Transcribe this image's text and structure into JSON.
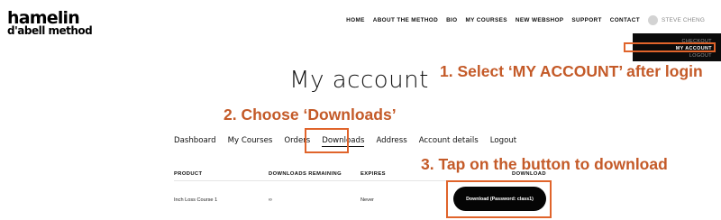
{
  "logo": {
    "line1": "hamelin",
    "line2": "d'abell method"
  },
  "nav": {
    "items": [
      "HOME",
      "ABOUT THE METHOD",
      "BIO",
      "MY COURSES",
      "NEW WEBSHOP",
      "SUPPORT",
      "CONTACT"
    ],
    "user_name": "STEVE CHENG"
  },
  "account_dropdown": {
    "items": [
      "CHECKOUT",
      "MY ACCOUNT",
      "LOGOUT"
    ]
  },
  "page_title": "My account",
  "tabs": [
    "Dashboard",
    "My Courses",
    "Orders",
    "Downloads",
    "Address",
    "Account details",
    "Logout"
  ],
  "active_tab": "Downloads",
  "table": {
    "headers": [
      "PRODUCT",
      "DOWNLOADS REMAINING",
      "EXPIRES",
      "DOWNLOAD"
    ],
    "rows": [
      {
        "product": "Inch Loss Course 1",
        "remaining": "∞",
        "expires": "Never",
        "button": "Download (Password: class1)"
      }
    ]
  },
  "annotations": {
    "step1": "1. Select ‘MY ACCOUNT’ after login",
    "step2": "2. Choose ‘Downloads’",
    "step3": "3. Tap on the button to download"
  },
  "colors": {
    "annotation": "#c45a28",
    "highlight_box": "#e0642b",
    "dropdown_bg": "#0b0b0b",
    "button_bg": "#050505"
  }
}
